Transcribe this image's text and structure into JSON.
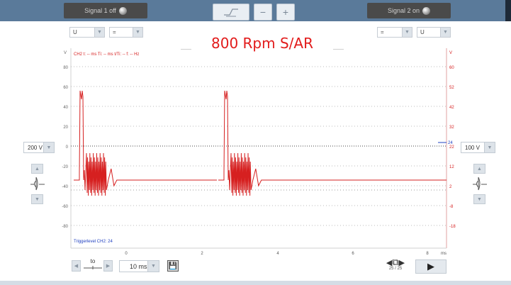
{
  "toolbar": {
    "signal1_label": "Signal 1 off",
    "signal2_label": "Signal 2 on",
    "trigger_icon": "trigger-edge-icon",
    "zoom_out_label": "−",
    "zoom_in_label": "+"
  },
  "selectors": {
    "left_channel": "U",
    "left_coupling": "=",
    "right_coupling": "=",
    "right_channel": "U"
  },
  "title": "800 Rpm S/AR",
  "scope": {
    "header_text": "CH2 t: -- ms  Ti: -- ms  t/Ti: --  f: -- Hz",
    "left_axis_unit": "V",
    "right_axis_unit": "V",
    "left_ticks": [
      "80",
      "60",
      "40",
      "20",
      "0",
      "-20",
      "-40",
      "-60",
      "-80"
    ],
    "right_ticks": [
      "60",
      "52",
      "42",
      "32",
      "22",
      "12",
      "2",
      "-8",
      "-18"
    ],
    "right_marker": "24",
    "x_ticks": [
      "0",
      "2",
      "4",
      "6",
      "8"
    ],
    "x_unit": "ms",
    "trigger_label": "Triggerlevel CH2: 24",
    "trace_color": "#d62020",
    "dotted_color": "#8a8a8a"
  },
  "left_volts": "200 V",
  "right_volts": "100 V",
  "timebase": {
    "to_label": "to",
    "value": "10 ms"
  },
  "page": {
    "current": "25 / 25"
  }
}
